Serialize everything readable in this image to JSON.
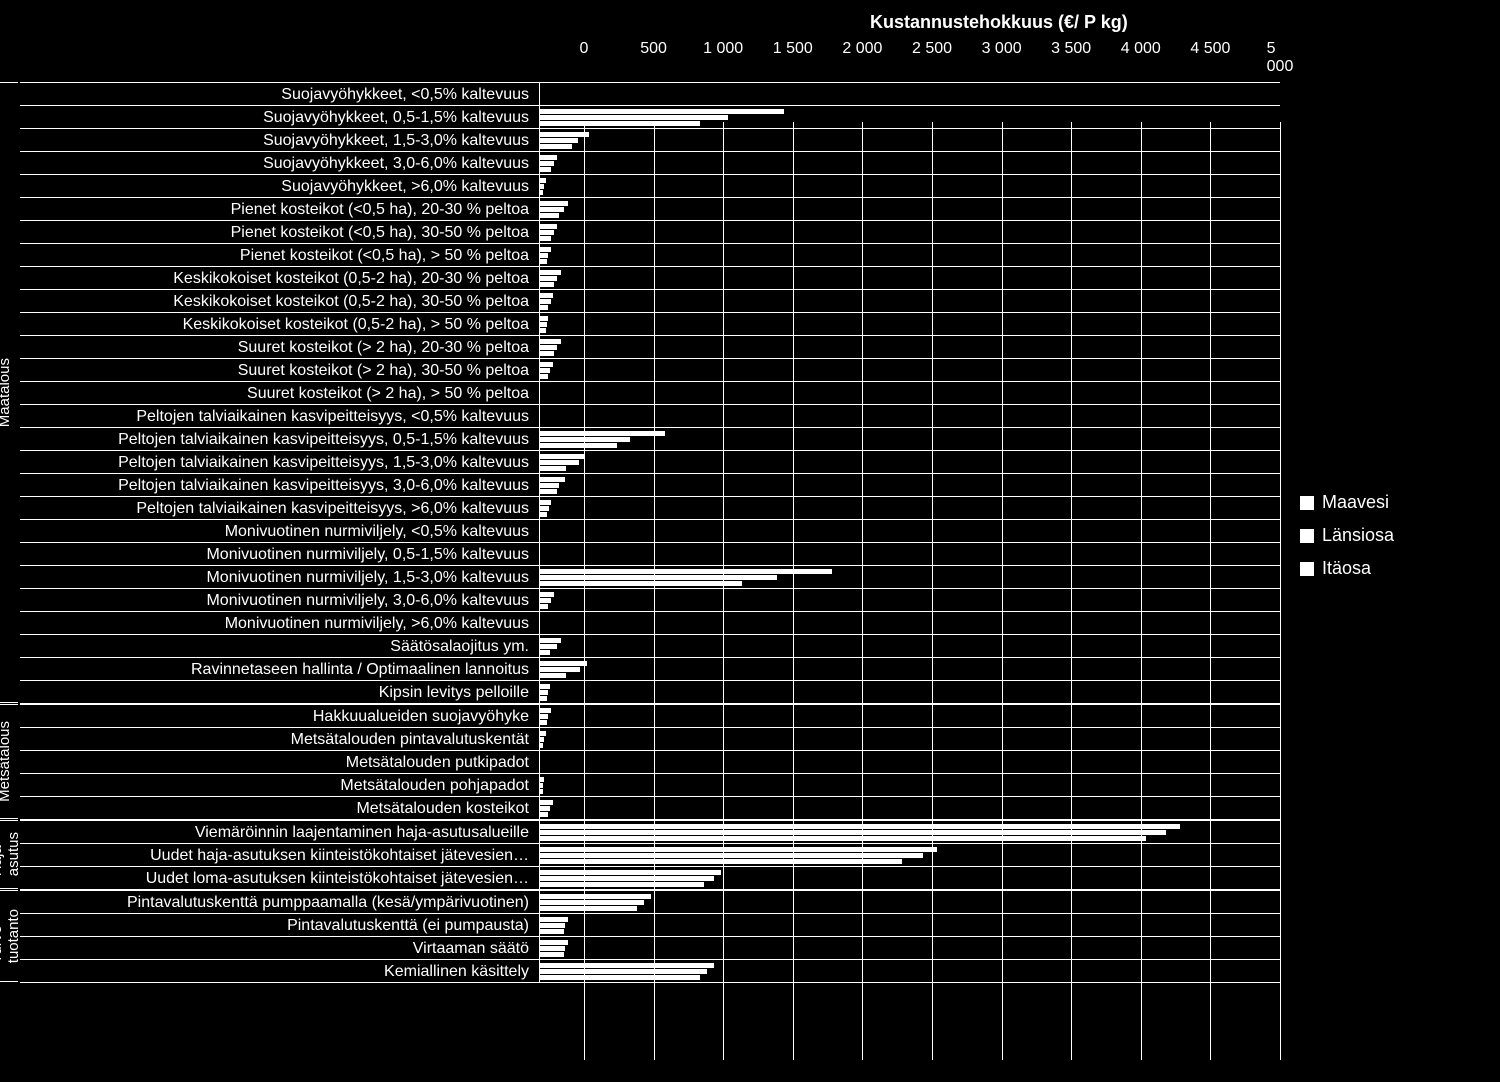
{
  "chart_data": {
    "type": "bar",
    "title": "Kustannustehokkuus (€/ P kg)",
    "xlabel": "Kustannustehokkuus (€/ P kg)",
    "ylabel": "",
    "xlim": [
      0,
      5000
    ],
    "x_ticks": [
      0,
      500,
      1000,
      1500,
      2000,
      2500,
      3000,
      3500,
      4000,
      4500,
      5000
    ],
    "x_tick_labels": [
      "0",
      "500",
      "1 000",
      "1 500",
      "2 000",
      "2 500",
      "3 000",
      "3 500",
      "4 000",
      "4 500",
      "5 000"
    ],
    "legend": [
      "Maavesi",
      "Länsiosa",
      "Itäosa"
    ],
    "groups": [
      {
        "name": "Maatalous",
        "items": [
          {
            "label": "Suojavyöhykkeet, <0,5% kaltevuus",
            "v": [
              0,
              0,
              0
            ]
          },
          {
            "label": "Suojavyöhykkeet, 0,5-1,5% kaltevuus",
            "v": [
              1750,
              1350,
              1150
            ]
          },
          {
            "label": "Suojavyöhykkeet, 1,5-3,0% kaltevuus",
            "v": [
              350,
              270,
              230
            ]
          },
          {
            "label": "Suojavyöhykkeet, 3,0-6,0% kaltevuus",
            "v": [
              120,
              100,
              80
            ]
          },
          {
            "label": "Suojavyöhykkeet, >6,0% kaltevuus",
            "v": [
              40,
              30,
              20
            ]
          },
          {
            "label": "Pienet kosteikot (<0,5 ha), 20-30 % peltoa",
            "v": [
              200,
              170,
              140
            ]
          },
          {
            "label": "Pienet kosteikot (<0,5 ha), 30-50 % peltoa",
            "v": [
              120,
              100,
              80
            ]
          },
          {
            "label": "Pienet kosteikot (<0,5 ha), > 50 % peltoa",
            "v": [
              80,
              60,
              50
            ]
          },
          {
            "label": "Keskikokoiset kosteikot (0,5-2 ha), 20-30 % peltoa",
            "v": [
              150,
              120,
              100
            ]
          },
          {
            "label": "Keskikokoiset kosteikot (0,5-2 ha), 30-50 % peltoa",
            "v": [
              90,
              80,
              60
            ]
          },
          {
            "label": "Keskikokoiset kosteikot (0,5-2 ha), > 50 % peltoa",
            "v": [
              60,
              50,
              40
            ]
          },
          {
            "label": "Suuret kosteikot (> 2 ha), 20-30 % peltoa",
            "v": [
              150,
              120,
              100
            ]
          },
          {
            "label": "Suuret kosteikot (> 2 ha), 30-50 % peltoa",
            "v": [
              90,
              70,
              60
            ]
          },
          {
            "label": "Suuret kosteikot (> 2 ha), > 50 % peltoa",
            "v": [
              0,
              0,
              0
            ]
          },
          {
            "label": "Peltojen talviaikainen kasvipeitteisyys, <0,5% kaltevuus",
            "v": [
              0,
              0,
              0
            ]
          },
          {
            "label": "Peltojen talviaikainen kasvipeitteisyys, 0,5-1,5% kaltevuus",
            "v": [
              900,
              650,
              550
            ]
          },
          {
            "label": "Peltojen talviaikainen kasvipeitteisyys, 1,5-3,0% kaltevuus",
            "v": [
              320,
              280,
              190
            ]
          },
          {
            "label": "Peltojen talviaikainen kasvipeitteisyys, 3,0-6,0% kaltevuus",
            "v": [
              180,
              140,
              120
            ]
          },
          {
            "label": "Peltojen talviaikainen kasvipeitteisyys, >6,0% kaltevuus",
            "v": [
              80,
              65,
              50
            ]
          },
          {
            "label": "Monivuotinen nurmiviljely, <0,5% kaltevuus",
            "v": [
              0,
              0,
              0
            ]
          },
          {
            "label": "Monivuotinen nurmiviljely, 0,5-1,5% kaltevuus",
            "v": [
              0,
              0,
              0
            ]
          },
          {
            "label": "Monivuotinen nurmiviljely, 1,5-3,0% kaltevuus",
            "v": [
              2100,
              1700,
              1450
            ]
          },
          {
            "label": "Monivuotinen nurmiviljely, 3,0-6,0% kaltevuus",
            "v": [
              100,
              80,
              60
            ]
          },
          {
            "label": "Monivuotinen nurmiviljely, >6,0% kaltevuus",
            "v": [
              0,
              0,
              0
            ]
          },
          {
            "label": "Säätösalaojitus ym.",
            "v": [
              150,
              120,
              70
            ]
          },
          {
            "label": "Ravinnetaseen hallinta / Optimaalinen lannoitus",
            "v": [
              340,
              290,
              190
            ]
          },
          {
            "label": "Kipsin levitys pelloille",
            "v": [
              70,
              60,
              50
            ]
          }
        ]
      },
      {
        "name": "Metsätalous",
        "items": [
          {
            "label": "Hakkuualueiden suojavyöhyke",
            "v": [
              80,
              60,
              50
            ]
          },
          {
            "label": "Metsätalouden pintavalutuskentät",
            "v": [
              40,
              30,
              25
            ]
          },
          {
            "label": "Metsätalouden putkipadot",
            "v": [
              0,
              0,
              0
            ]
          },
          {
            "label": "Metsätalouden pohjapadot",
            "v": [
              30,
              25,
              20
            ]
          },
          {
            "label": "Metsätalouden kosteikot",
            "v": [
              90,
              70,
              60
            ]
          }
        ]
      },
      {
        "name": "Haja-\nasutus",
        "display_name": "Haja-asutus",
        "items": [
          {
            "label": "Viemäröinnin laajentaminen haja-asutusalueille",
            "v": [
              4600,
              4500,
              4350
            ]
          },
          {
            "label": "Uudet haja-asutuksen kiinteistökohtaiset jätevesien…",
            "v": [
              2850,
              2750,
              2600
            ]
          },
          {
            "label": "Uudet loma-asutuksen kiinteistökohtaiset jätevesien…",
            "v": [
              1300,
              1250,
              1180
            ]
          }
        ]
      },
      {
        "name": "Turve-\ntuotanto",
        "display_name": "Turve-tuotanto",
        "items": [
          {
            "label": "Pintavalutuskenttä pumppaamalla (kesä/ympärivuotinen)",
            "v": [
              800,
              750,
              700
            ]
          },
          {
            "label": "Pintavalutuskenttä (ei pumpausta)",
            "v": [
              200,
              180,
              170
            ]
          },
          {
            "label": "Virtaaman säätö",
            "v": [
              200,
              180,
              170
            ]
          },
          {
            "label": "Kemiallinen käsittely",
            "v": [
              1250,
              1200,
              1150
            ]
          }
        ]
      }
    ]
  }
}
